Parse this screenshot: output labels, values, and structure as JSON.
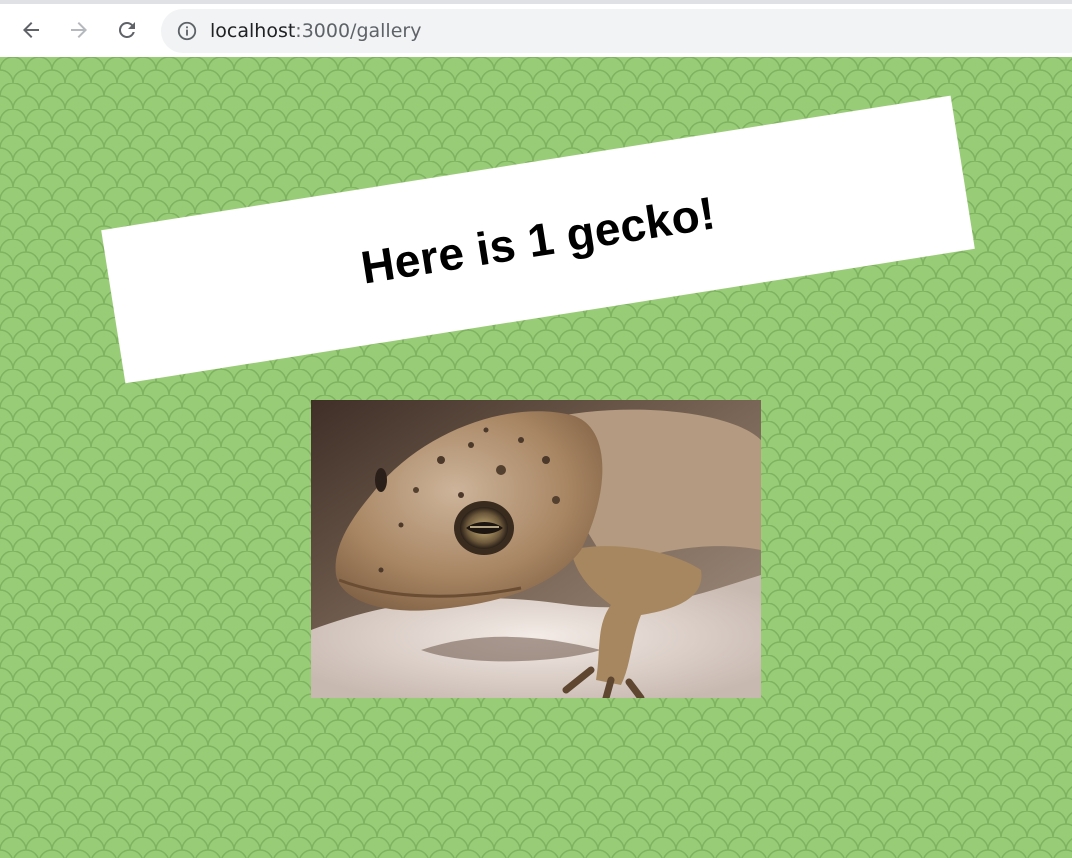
{
  "browser": {
    "url_host": "localhost",
    "url_path": ":3000/gallery",
    "back_icon": "arrow-left-icon",
    "forward_icon": "arrow-right-icon",
    "reload_icon": "reload-icon",
    "info_icon": "info-icon"
  },
  "page": {
    "background_color": "#99cc77",
    "heading": "Here is 1 gecko!"
  },
  "gallery": {
    "images": [
      {
        "subject": "gecko"
      }
    ]
  }
}
